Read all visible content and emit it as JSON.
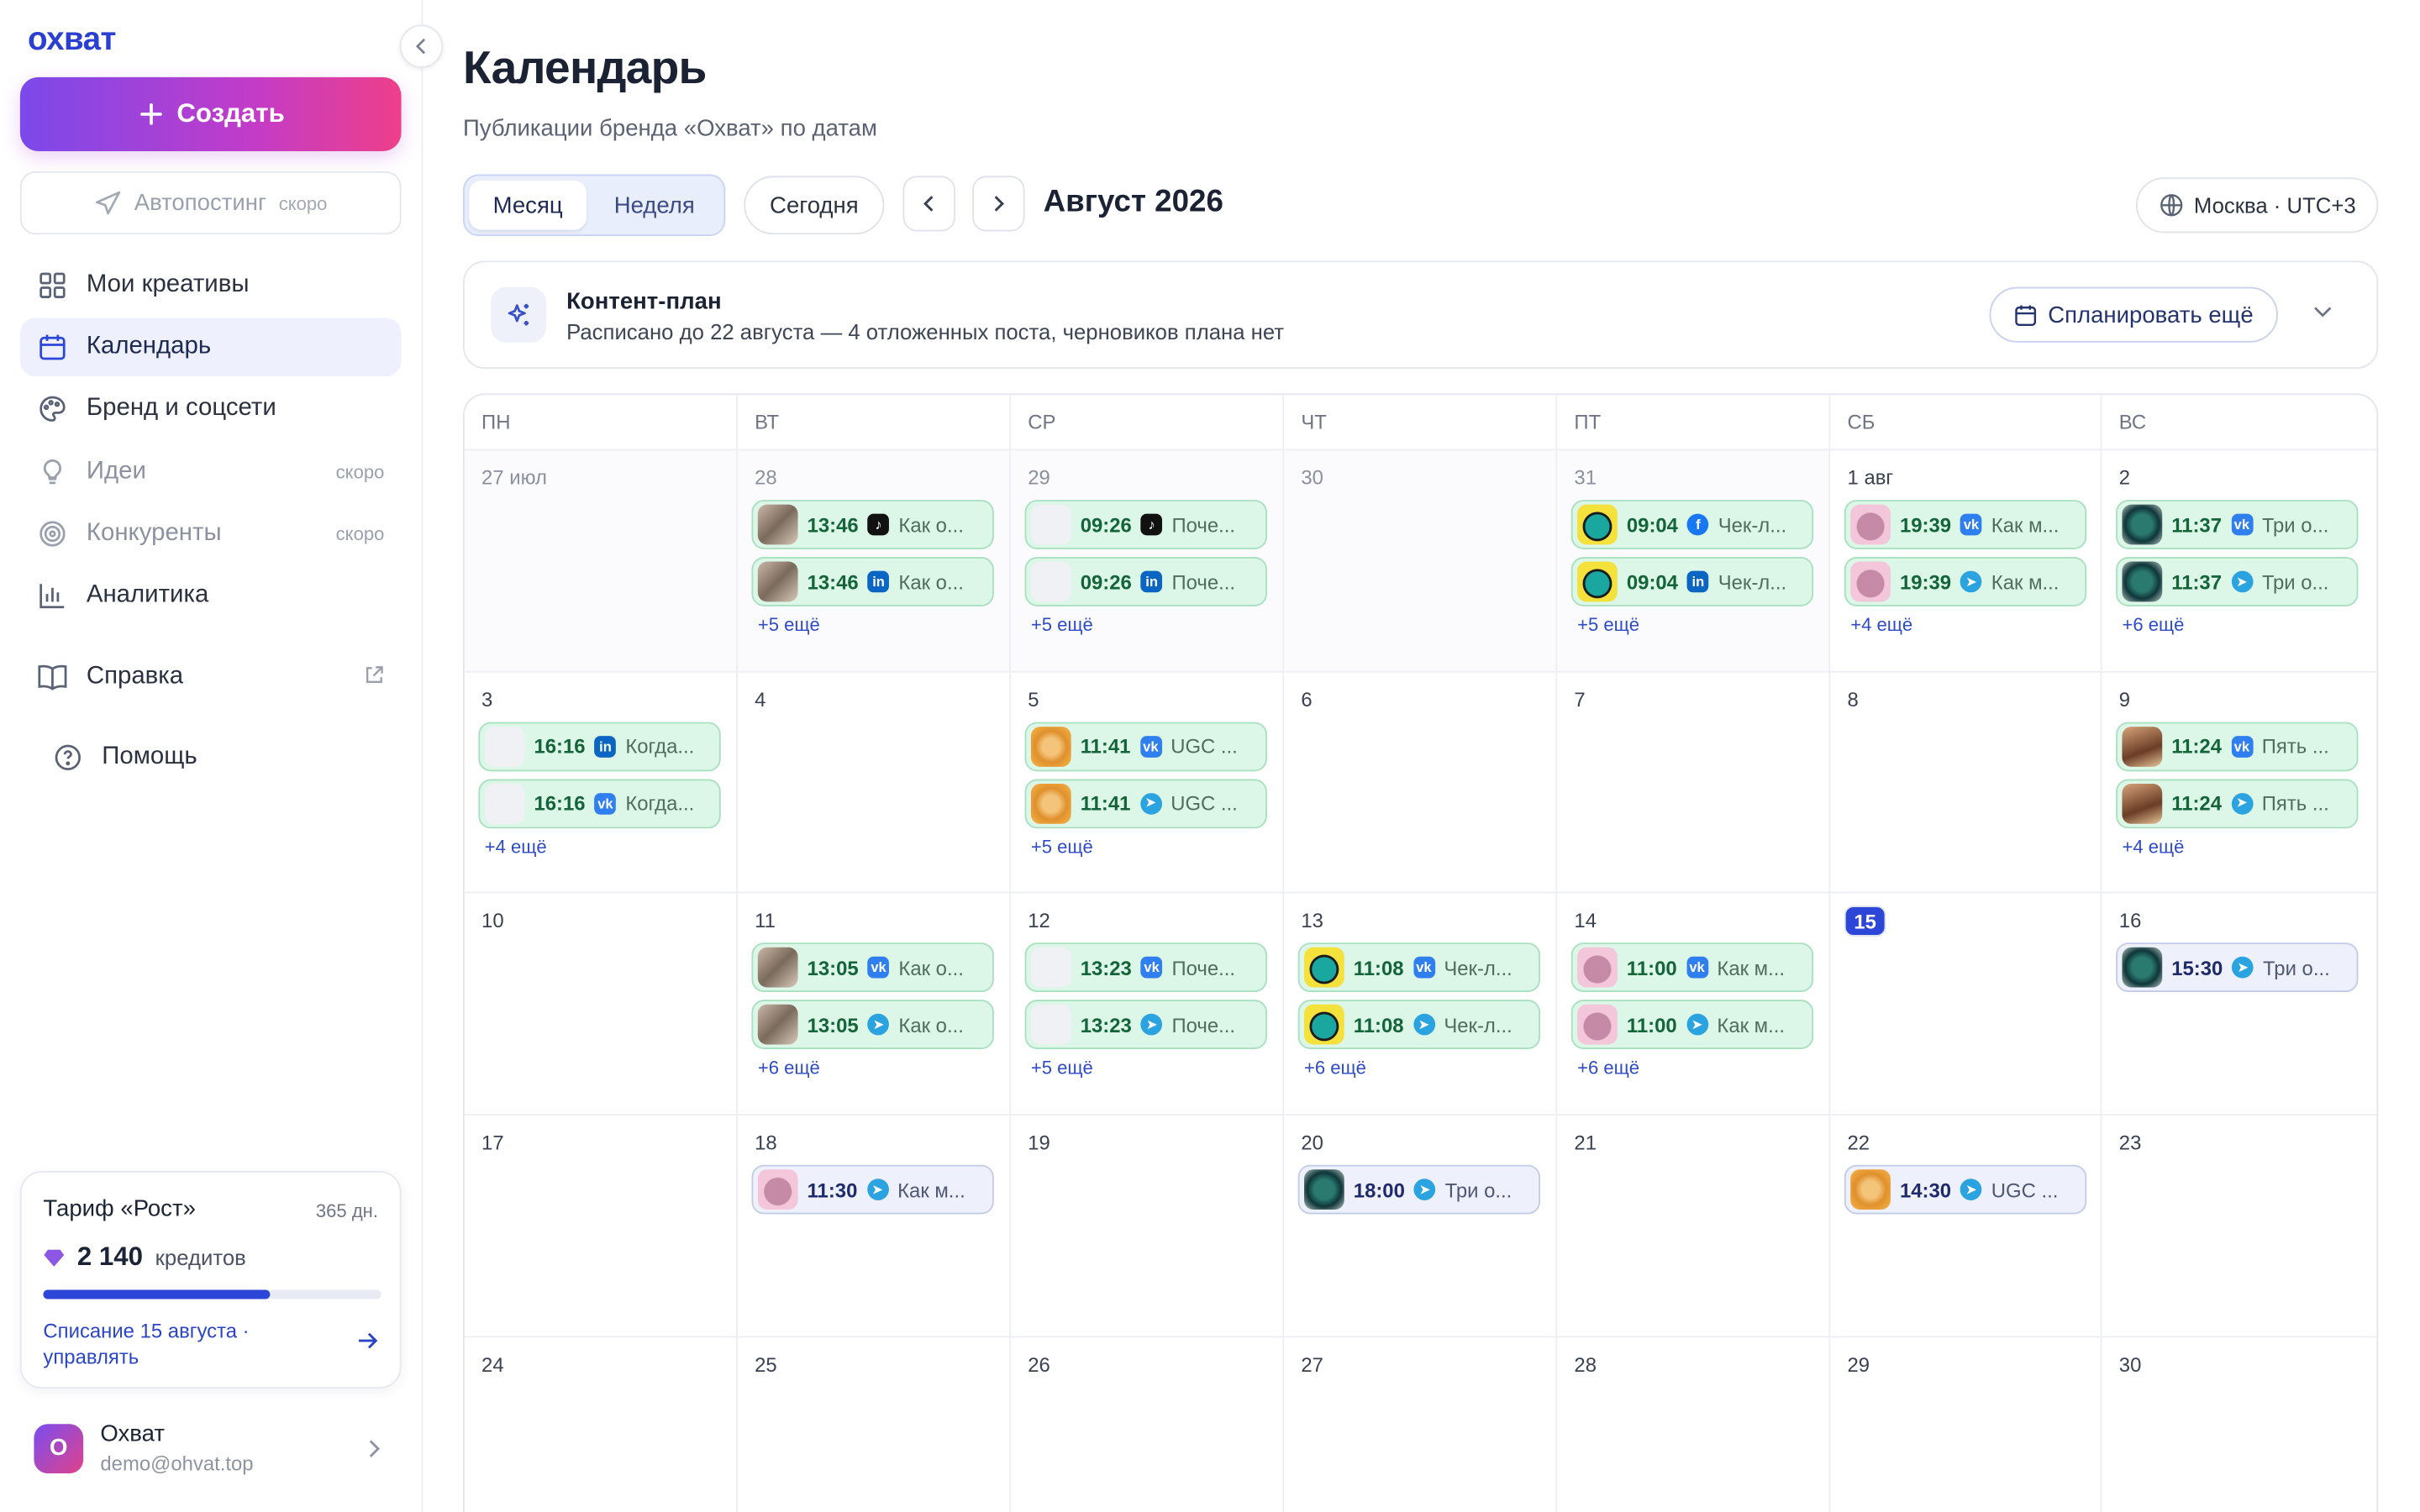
{
  "app": {
    "logo": "охват"
  },
  "sidebar": {
    "create_label": "Создать",
    "autopost": {
      "label": "Автопостинг",
      "badge": "скоро"
    },
    "items": [
      {
        "label": "Мои креативы"
      },
      {
        "label": "Календарь"
      },
      {
        "label": "Бренд и соцсети"
      },
      {
        "label": "Идеи",
        "badge": "скоро"
      },
      {
        "label": "Конкуренты",
        "badge": "скоро"
      },
      {
        "label": "Аналитика"
      },
      {
        "label": "Справка"
      },
      {
        "label": "Помощь"
      }
    ],
    "plan": {
      "title": "Тариф «Рост»",
      "days": "365 дн.",
      "credits": "2 140",
      "credits_unit": "кредитов",
      "progress": 0.67,
      "charge": "Списание 15 августа · управлять"
    },
    "user": {
      "initial": "О",
      "name": "Охват",
      "email": "demo@ohvat.top"
    }
  },
  "header": {
    "title": "Календарь",
    "subtitle": "Публикации бренда «Охват» по датам",
    "view_month": "Месяц",
    "view_week": "Неделя",
    "today": "Сегодня",
    "month_label": "Август 2026",
    "timezone": "Москва · UTC+3"
  },
  "content_plan": {
    "title": "Контент-план",
    "desc": "Расписано до 22 августа — 4 отложенных поста, черновиков плана нет",
    "button": "Спланировать ещё"
  },
  "calendar": {
    "weekdays": [
      "ПН",
      "ВТ",
      "СР",
      "ЧТ",
      "ПТ",
      "СБ",
      "ВС"
    ],
    "days": [
      {
        "d": "27 июл",
        "prev": true
      },
      {
        "d": "28",
        "prev": true,
        "posts": [
          {
            "time": "13:46",
            "net": "tiktok",
            "title": "Как о...",
            "thumb": "th1",
            "st": "g"
          },
          {
            "time": "13:46",
            "net": "linkedin",
            "title": "Как о...",
            "thumb": "th1",
            "st": "g"
          }
        ],
        "more": "+5 ещё"
      },
      {
        "d": "29",
        "prev": true,
        "posts": [
          {
            "time": "09:26",
            "net": "tiktok",
            "title": "Поче...",
            "thumb": "th2",
            "st": "g"
          },
          {
            "time": "09:26",
            "net": "linkedin",
            "title": "Поче...",
            "thumb": "th2",
            "st": "g"
          }
        ],
        "more": "+5 ещё"
      },
      {
        "d": "30",
        "prev": true
      },
      {
        "d": "31",
        "prev": true,
        "posts": [
          {
            "time": "09:04",
            "net": "facebook",
            "title": "Чек-л...",
            "thumb": "th3",
            "st": "g"
          },
          {
            "time": "09:04",
            "net": "linkedin",
            "title": "Чек-л...",
            "thumb": "th3",
            "st": "g"
          }
        ],
        "more": "+5 ещё"
      },
      {
        "d": "1 авг",
        "posts": [
          {
            "time": "19:39",
            "net": "vk",
            "title": "Как м...",
            "thumb": "th4",
            "st": "g"
          },
          {
            "time": "19:39",
            "net": "telegram",
            "title": "Как м...",
            "thumb": "th4",
            "st": "g"
          }
        ],
        "more": "+4 ещё"
      },
      {
        "d": "2",
        "posts": [
          {
            "time": "11:37",
            "net": "vk",
            "title": "Три о...",
            "thumb": "th5",
            "st": "g"
          },
          {
            "time": "11:37",
            "net": "telegram",
            "title": "Три о...",
            "thumb": "th5",
            "st": "g"
          }
        ],
        "more": "+6 ещё"
      },
      {
        "d": "3",
        "posts": [
          {
            "time": "16:16",
            "net": "linkedin",
            "title": "Когда...",
            "thumb": "th2",
            "st": "g"
          },
          {
            "time": "16:16",
            "net": "vk",
            "title": "Когда...",
            "thumb": "th2",
            "st": "g"
          }
        ],
        "more": "+4 ещё"
      },
      {
        "d": "4"
      },
      {
        "d": "5",
        "posts": [
          {
            "time": "11:41",
            "net": "vk",
            "title": "UGC ...",
            "thumb": "th6",
            "st": "g"
          },
          {
            "time": "11:41",
            "net": "telegram",
            "title": "UGC ...",
            "thumb": "th6",
            "st": "g"
          }
        ],
        "more": "+5 ещё"
      },
      {
        "d": "6"
      },
      {
        "d": "7"
      },
      {
        "d": "8"
      },
      {
        "d": "9",
        "posts": [
          {
            "time": "11:24",
            "net": "vk",
            "title": "Пять ...",
            "thumb": "th7",
            "st": "g"
          },
          {
            "time": "11:24",
            "net": "telegram",
            "title": "Пять ...",
            "thumb": "th7",
            "st": "g"
          }
        ],
        "more": "+4 ещё"
      },
      {
        "d": "10"
      },
      {
        "d": "11",
        "posts": [
          {
            "time": "13:05",
            "net": "vk",
            "title": "Как о...",
            "thumb": "th1",
            "st": "g"
          },
          {
            "time": "13:05",
            "net": "telegram",
            "title": "Как о...",
            "thumb": "th1",
            "st": "g"
          }
        ],
        "more": "+6 ещё"
      },
      {
        "d": "12",
        "posts": [
          {
            "time": "13:23",
            "net": "vk",
            "title": "Поче...",
            "thumb": "th2",
            "st": "g"
          },
          {
            "time": "13:23",
            "net": "telegram",
            "title": "Поче...",
            "thumb": "th2",
            "st": "g"
          }
        ],
        "more": "+5 ещё"
      },
      {
        "d": "13",
        "posts": [
          {
            "time": "11:08",
            "net": "vk",
            "title": "Чек-л...",
            "thumb": "th3",
            "st": "g"
          },
          {
            "time": "11:08",
            "net": "telegram",
            "title": "Чек-л...",
            "thumb": "th3",
            "st": "g"
          }
        ],
        "more": "+6 ещё"
      },
      {
        "d": "14",
        "posts": [
          {
            "time": "11:00",
            "net": "vk",
            "title": "Как м...",
            "thumb": "th4",
            "st": "g"
          },
          {
            "time": "11:00",
            "net": "telegram",
            "title": "Как м...",
            "thumb": "th4",
            "st": "g"
          }
        ],
        "more": "+6 ещё"
      },
      {
        "d": "15",
        "today": true
      },
      {
        "d": "16",
        "posts": [
          {
            "time": "15:30",
            "net": "telegram",
            "title": "Три о...",
            "thumb": "th5",
            "st": "b"
          }
        ]
      },
      {
        "d": "17"
      },
      {
        "d": "18",
        "posts": [
          {
            "time": "11:30",
            "net": "telegram",
            "title": "Как м...",
            "thumb": "th4",
            "st": "b"
          }
        ]
      },
      {
        "d": "19"
      },
      {
        "d": "20",
        "posts": [
          {
            "time": "18:00",
            "net": "telegram",
            "title": "Три о...",
            "thumb": "th5",
            "st": "b"
          }
        ]
      },
      {
        "d": "21"
      },
      {
        "d": "22",
        "posts": [
          {
            "time": "14:30",
            "net": "telegram",
            "title": "UGC ...",
            "thumb": "th6",
            "st": "b"
          }
        ]
      },
      {
        "d": "23"
      },
      {
        "d": "24"
      },
      {
        "d": "25"
      },
      {
        "d": "26"
      },
      {
        "d": "27"
      },
      {
        "d": "28"
      },
      {
        "d": "29"
      },
      {
        "d": "30"
      }
    ]
  }
}
